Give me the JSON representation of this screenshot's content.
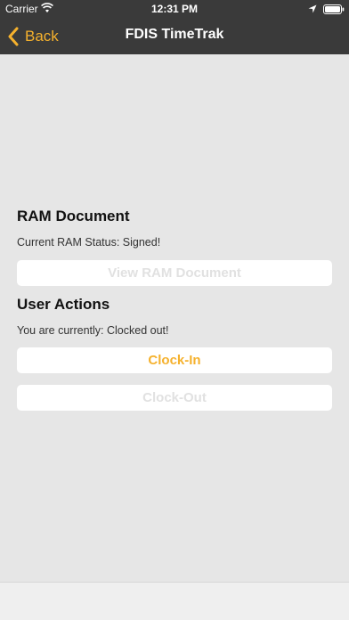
{
  "status_bar": {
    "carrier": "Carrier",
    "time": "12:31 PM"
  },
  "nav": {
    "back_label": "Back",
    "title": "FDIS TimeTrak"
  },
  "ram": {
    "heading": "RAM Document",
    "status_text": "Current RAM Status: Signed!",
    "view_button_label": "View RAM Document"
  },
  "user_actions": {
    "heading": "User Actions",
    "status_text": "You are currently: Clocked out!",
    "clock_in_label": "Clock-In",
    "clock_out_label": "Clock-Out"
  },
  "colors": {
    "accent": "#f5b12d",
    "nav_bg": "#3a3a3a",
    "page_bg": "#e6e6e6",
    "disabled_text": "#e1e1e1"
  }
}
